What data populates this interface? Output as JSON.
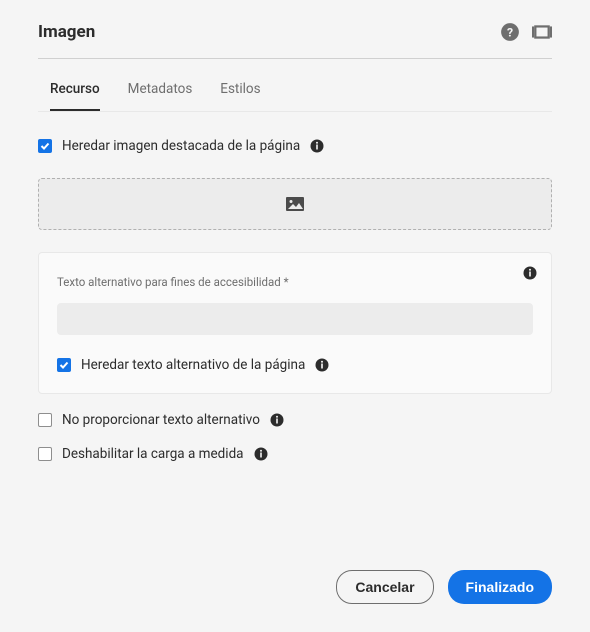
{
  "header": {
    "title": "Imagen"
  },
  "tabs": {
    "items": [
      {
        "label": "Recurso",
        "active": true
      },
      {
        "label": "Metadatos",
        "active": false
      },
      {
        "label": "Estilos",
        "active": false
      }
    ]
  },
  "fields": {
    "inherit_featured": {
      "label": "Heredar imagen destacada de la página",
      "checked": true
    },
    "alt_text_panel": {
      "label": "Texto alternativo para fines de accesibilidad *",
      "value": "",
      "inherit_alt": {
        "label": "Heredar texto alternativo de la página",
        "checked": true
      }
    },
    "no_alt": {
      "label": "No proporcionar texto alternativo",
      "checked": false
    },
    "disable_lazy": {
      "label": "Deshabilitar la carga a medida",
      "checked": false
    }
  },
  "footer": {
    "cancel": "Cancelar",
    "done": "Finalizado"
  }
}
